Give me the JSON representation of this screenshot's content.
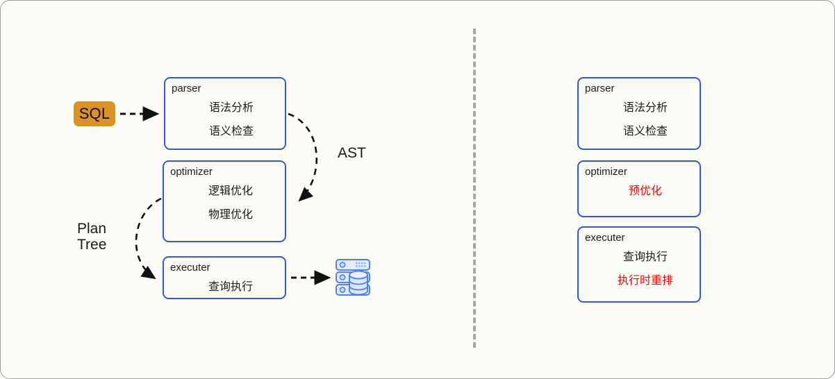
{
  "diagram": {
    "title": "SQL query processing pipeline comparison",
    "colors": {
      "canvas_bg": "#fdfdf8",
      "box_border": "#3355ee",
      "sql_badge_bg": "#d99425",
      "accent_red": "#ff0000",
      "divider": "#a6a6a6",
      "db_icon_blue": "#4e83f5",
      "db_icon_fill": "#dce6fb"
    },
    "left_panel": {
      "sql_badge": {
        "label": "SQL",
        "name": "sql-input-badge"
      },
      "boxes": [
        {
          "title": "parser",
          "lines": [
            {
              "text": "语法分析",
              "accent": false
            },
            {
              "text": "语义检查",
              "accent": false
            }
          ]
        },
        {
          "title": "optimizer",
          "lines": [
            {
              "text": "逻辑优化",
              "accent": false
            },
            {
              "text": "物理优化",
              "accent": false
            }
          ]
        },
        {
          "title": "executer",
          "lines": [
            {
              "text": "查询执行",
              "accent": false
            }
          ]
        }
      ],
      "edge_labels": {
        "ast": "AST",
        "plan_tree": "Plan\nTree"
      },
      "storage_icon": "database-server-icon"
    },
    "right_panel": {
      "boxes": [
        {
          "title": "parser",
          "lines": [
            {
              "text": "语法分析",
              "accent": false
            },
            {
              "text": "语义检查",
              "accent": false
            }
          ]
        },
        {
          "title": "optimizer",
          "lines": [
            {
              "text": "预优化",
              "accent": true
            }
          ]
        },
        {
          "title": "executer",
          "lines": [
            {
              "text": "查询执行",
              "accent": false
            },
            {
              "text": "执行时重排",
              "accent": true
            }
          ]
        }
      ]
    }
  }
}
